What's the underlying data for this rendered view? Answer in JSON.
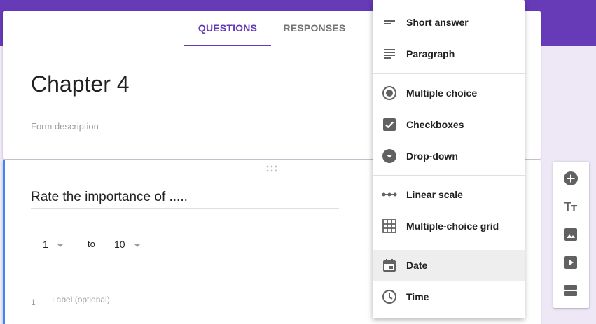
{
  "colors": {
    "brand": "#673ab7",
    "accent_left_bar": "#4285f4",
    "icon_grey": "#616161"
  },
  "tabs": [
    {
      "label": "QUESTIONS",
      "active": true
    },
    {
      "label": "RESPONSES",
      "active": false
    }
  ],
  "form": {
    "title": "Chapter 4",
    "description_placeholder": "Form description"
  },
  "question": {
    "title": "Rate the importance of .....",
    "scale_min": "1",
    "to_label": "to",
    "scale_max": "10",
    "label_number": "1",
    "label_placeholder": "Label (optional)"
  },
  "type_menu": {
    "items": [
      {
        "label": "Short answer",
        "icon": "short-answer-icon"
      },
      {
        "label": "Paragraph",
        "icon": "paragraph-icon"
      },
      {
        "label": "Multiple choice",
        "icon": "radio-icon"
      },
      {
        "label": "Checkboxes",
        "icon": "checkbox-icon"
      },
      {
        "label": "Drop-down",
        "icon": "dropdown-icon"
      },
      {
        "label": "Linear scale",
        "icon": "linear-scale-icon"
      },
      {
        "label": "Multiple-choice grid",
        "icon": "grid-icon"
      },
      {
        "label": "Date",
        "icon": "calendar-icon",
        "selected": true
      },
      {
        "label": "Time",
        "icon": "clock-icon"
      }
    ]
  },
  "toolbar": {
    "buttons": [
      "add-question-icon",
      "add-title-icon",
      "add-image-icon",
      "add-video-icon",
      "add-section-icon"
    ]
  }
}
